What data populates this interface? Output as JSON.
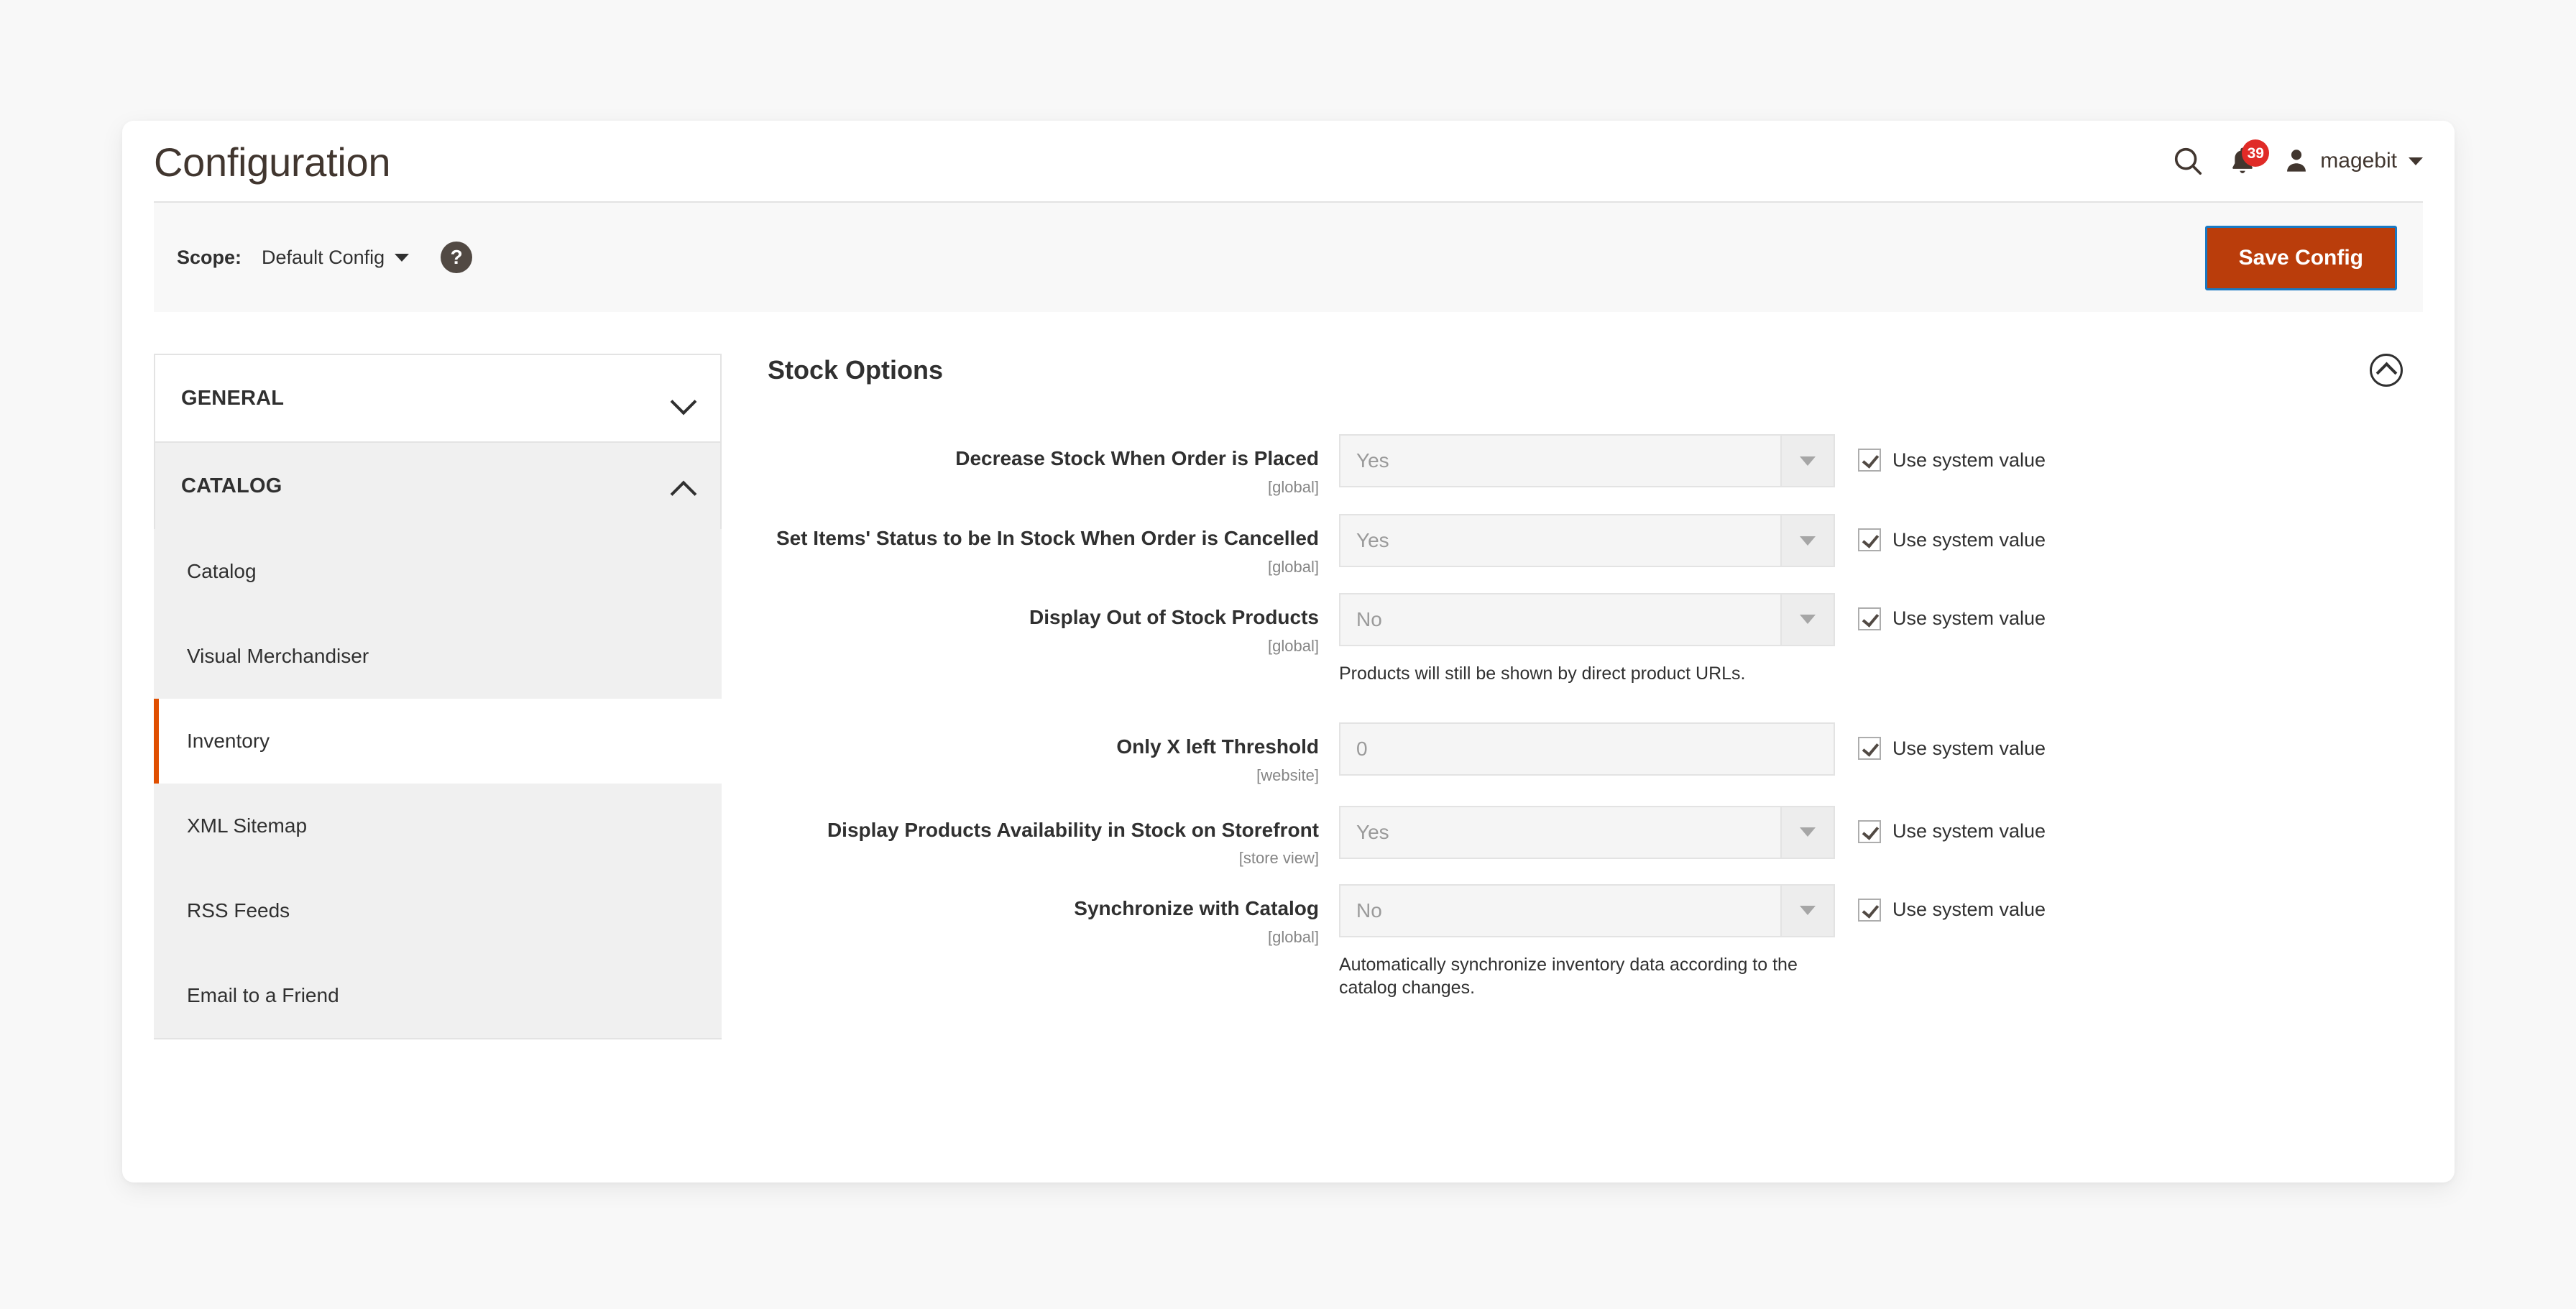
{
  "header": {
    "title": "Configuration",
    "search_icon": "search-icon",
    "notifications_icon": "bell-icon",
    "notifications_count": "39",
    "user_icon": "user-avatar-icon",
    "user_name": "magebit",
    "user_caret": "chevron-down-icon"
  },
  "scope_bar": {
    "label": "Scope:",
    "value": "Default Config",
    "help_icon": "question-mark-icon",
    "save_label": "Save Config",
    "save_color": "#ba3d0b",
    "focus_outline_color": "#1979c3"
  },
  "sidebar": {
    "sections": [
      {
        "title": "GENERAL",
        "expanded": false,
        "chevron": "chevron-down-icon",
        "items": []
      },
      {
        "title": "CATALOG",
        "expanded": true,
        "chevron": "chevron-up-icon",
        "items": [
          {
            "label": "Catalog",
            "active": false
          },
          {
            "label": "Visual Merchandiser",
            "active": false
          },
          {
            "label": "Inventory",
            "active": true
          },
          {
            "label": "XML Sitemap",
            "active": false
          },
          {
            "label": "RSS Feeds",
            "active": false
          },
          {
            "label": "Email to a Friend",
            "active": false
          }
        ]
      }
    ],
    "active_accent_color": "#e04f00"
  },
  "main": {
    "section_title": "Stock Options",
    "collapse_icon": "chevron-up-circle-icon",
    "system_value_label": "Use system value",
    "fields": [
      {
        "label": "Decrease Stock When Order is Placed",
        "scope": "[global]",
        "type": "select",
        "value": "Yes",
        "note": "",
        "use_system_value": true
      },
      {
        "label": "Set Items' Status to be In Stock When Order is Cancelled",
        "scope": "[global]",
        "type": "select",
        "value": "Yes",
        "note": "",
        "use_system_value": true
      },
      {
        "label": "Display Out of Stock Products",
        "scope": "[global]",
        "type": "select",
        "value": "No",
        "note": "Products will still be shown by direct product URLs.",
        "use_system_value": true
      },
      {
        "label": "Only X left Threshold",
        "scope": "[website]",
        "type": "text",
        "value": "0",
        "note": "",
        "use_system_value": true
      },
      {
        "label": "Display Products Availability in Stock on Storefront",
        "scope": "[store view]",
        "type": "select",
        "value": "Yes",
        "note": "",
        "use_system_value": true
      },
      {
        "label": "Synchronize with Catalog",
        "scope": "[global]",
        "type": "select",
        "value": "No",
        "note": "Automatically synchronize inventory data according to the catalog changes.",
        "use_system_value": true
      }
    ]
  }
}
